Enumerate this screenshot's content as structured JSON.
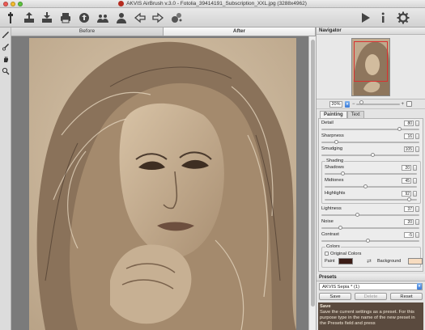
{
  "window": {
    "title": "AKVIS AirBrush v.3.0 - Fotolia_39414191_Subscription_XXL.jpg (3288x4962)"
  },
  "toolbar": {
    "left_icons": [
      "settings-icon",
      "open-icon",
      "save-icon",
      "print-icon",
      "share-icon",
      "batch-icon",
      "export-icon",
      "import-icon",
      "undo-icon",
      "redo-icon",
      "apply-icon"
    ],
    "right_icons": [
      "run-icon",
      "about-icon",
      "preferences-icon"
    ]
  },
  "tools": [
    "brush-icon",
    "history-brush-icon",
    "hand-icon",
    "zoom-icon"
  ],
  "view_tabs": {
    "before": "Before",
    "after": "After"
  },
  "navigator": {
    "header": "Navigator",
    "zoom": "20%",
    "zoom_level": 0.12
  },
  "settings": {
    "tabs": {
      "painting": "Painting",
      "text": "Text"
    },
    "params": {
      "detail": {
        "label": "Detail",
        "value": "80",
        "level": 0.8
      },
      "sharpness": {
        "label": "Sharpness",
        "value": "16",
        "level": 0.16
      },
      "smudging": {
        "label": "Smudging",
        "value": "105",
        "level": 0.53
      }
    },
    "shading": {
      "title": "Shading",
      "shadows": {
        "label": "Shadows",
        "value": "20",
        "level": 0.2
      },
      "midtones": {
        "label": "Midtones",
        "value": "45",
        "level": 0.45
      },
      "highlights": {
        "label": "Highlights",
        "value": "92",
        "level": 0.92
      }
    },
    "extra": {
      "lightness": {
        "label": "Lightness",
        "value": "37",
        "level": 0.37
      },
      "noise": {
        "label": "Noise",
        "value": "20",
        "level": 0.2
      },
      "contrast": {
        "label": "Contrast",
        "value": "-5",
        "level": 0.48
      }
    },
    "colors": {
      "title": "Colors",
      "original_colors": "Original Colors",
      "paint_label": "Paint",
      "background_label": "Background",
      "paint_color": "#3b1c16",
      "background_color": "#f7dcc0"
    }
  },
  "presets": {
    "header": "Presets",
    "selected": "AKVIS Sepia * (1)",
    "save": "Save",
    "delete": "Delete",
    "reset": "Reset"
  },
  "hint": {
    "title": "Save",
    "body": "Save the current settings as a preset. For this purpose type in the name of the new preset in the Presets field and press"
  },
  "colors": {
    "photo_base": "#c8b59d",
    "photo_dark": "#4b3a2d",
    "hair_light": "#e3d4bd"
  }
}
